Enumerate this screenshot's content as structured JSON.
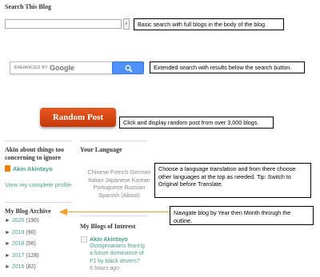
{
  "search_blog": {
    "title": "Search This Blog",
    "button_icon": "magnifier-icon"
  },
  "callouts": {
    "basic": "Basic search with full blogs in the body of the blog.",
    "extended": "Extended search with results below the search button.",
    "random": "Click and display random post from over 3,000 blogs.",
    "language": "Choose a language translation and from there choose other languages at the top as needed. Tip: Switch to Original before Translate.",
    "archive": "Navigate blog by Year then Month through the outline."
  },
  "google_search": {
    "enhanced_by": "ENHANCED BY",
    "google": "Google"
  },
  "random_post": {
    "label": "Random Post"
  },
  "about": {
    "title": "Akin about things too concerning to ignore",
    "author": "Akin Akintayo",
    "profile_link": "View my complete profile"
  },
  "language": {
    "title": "Your Language",
    "line1": "Chinese French German",
    "line2": "Italian Japanese Korean",
    "line3": "Portuguese Russian",
    "line4": "Spanish (About)"
  },
  "archive": {
    "title": "My Blog Archive",
    "items": [
      {
        "year": "2020",
        "count": "(190)"
      },
      {
        "year": "2019",
        "count": "(90)"
      },
      {
        "year": "2018",
        "count": "(56)"
      },
      {
        "year": "2017",
        "count": "(128)"
      },
      {
        "year": "2016",
        "count": "(82)"
      }
    ]
  },
  "blogs_interest": {
    "title": "My Blogs of Interest",
    "author": "Akin Akintayo",
    "post_line1": "Octogenarians fearing",
    "post_line2": "a future dominance of",
    "post_line3": "F1 by black drivers?",
    "time": "6 hours ago"
  },
  "colors": {
    "accent_teal": "#4d9f8c",
    "random_button": "#d44712",
    "google_button": "#4d90fe",
    "arrow": "#f2a02c"
  }
}
